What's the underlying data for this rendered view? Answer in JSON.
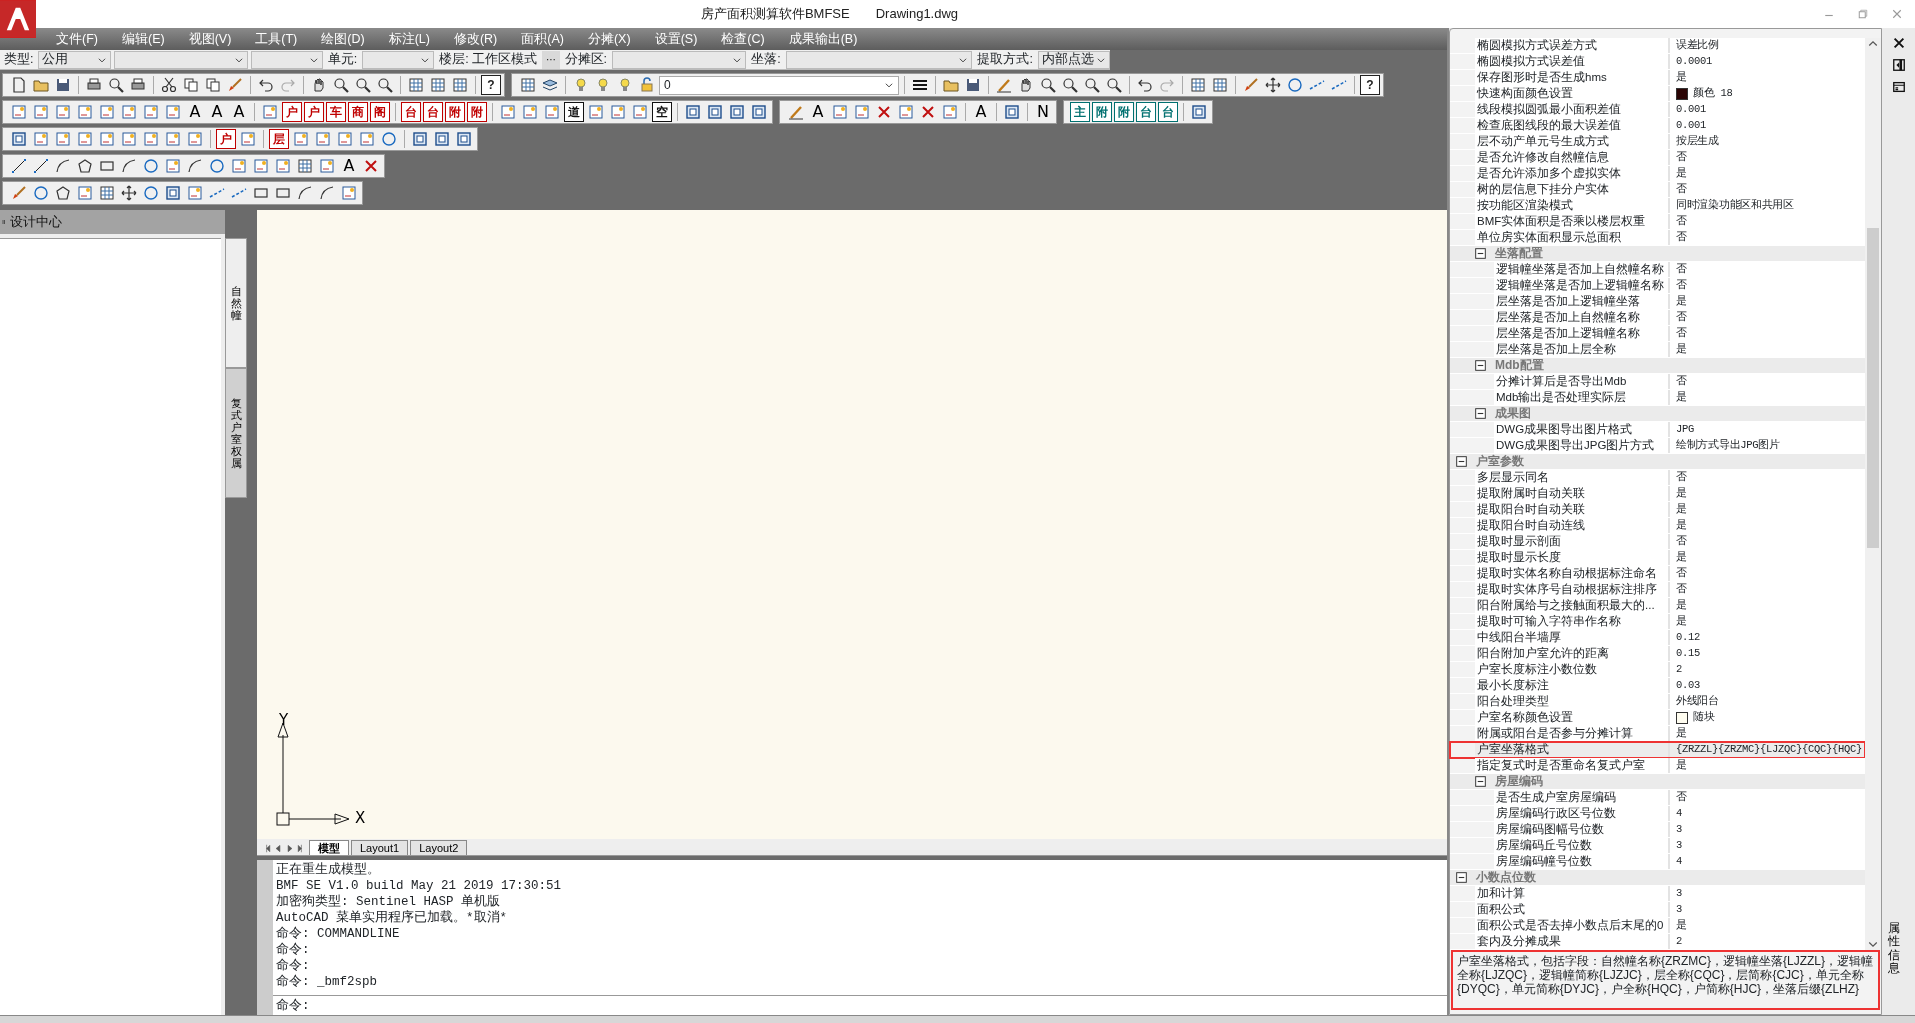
{
  "window": {
    "title": "房产面积测算软件BMFSE",
    "document": "Drawing1.dwg"
  },
  "menu": [
    "文件(F)",
    "编辑(E)",
    "视图(V)",
    "工具(T)",
    "绘图(D)",
    "标注(L)",
    "修改(R)",
    "面积(A)",
    "分摊(X)",
    "设置(S)",
    "检查(C)",
    "成果输出(B)"
  ],
  "filter_bar": [
    {
      "kind": "label",
      "text": "类型:"
    },
    {
      "kind": "combo",
      "value": "公用"
    },
    {
      "kind": "combo"
    },
    {
      "kind": "combo"
    },
    {
      "kind": "label",
      "text": "单元:"
    },
    {
      "kind": "combo"
    },
    {
      "kind": "label",
      "text": "楼层: 工作区模式"
    },
    {
      "kind": "more",
      "text": "···"
    },
    {
      "kind": "label",
      "text": "分摊区:"
    },
    {
      "kind": "combo"
    },
    {
      "kind": "label",
      "text": "坐落:"
    },
    {
      "kind": "combo"
    },
    {
      "kind": "label",
      "text": "提取方式:"
    },
    {
      "kind": "combo",
      "value": "内部点选"
    }
  ],
  "toolbar_rows": [
    {
      "toolbars": [
        {
          "items": [
            {
              "kind": "page"
            },
            {
              "kind": "folder"
            },
            {
              "kind": "disk"
            },
            {
              "kind": "sep"
            },
            {
              "kind": "printer"
            },
            {
              "kind": "zoom"
            },
            {
              "kind": "printer"
            },
            {
              "kind": "sep"
            },
            {
              "kind": "scissors"
            },
            {
              "kind": "copy"
            },
            {
              "kind": "copy"
            },
            {
              "kind": "brush"
            },
            {
              "kind": "sep"
            },
            {
              "kind": "undo"
            },
            {
              "kind": "redo"
            },
            {
              "kind": "sep"
            },
            {
              "kind": "hand"
            },
            {
              "kind": "zoom"
            },
            {
              "kind": "zoom"
            },
            {
              "kind": "zoom"
            },
            {
              "kind": "sep"
            },
            {
              "kind": "grid"
            },
            {
              "kind": "grid"
            },
            {
              "kind": "grid"
            },
            {
              "kind": "sep"
            },
            {
              "kind": "glyph",
              "text": "?",
              "color": "#222222"
            }
          ]
        },
        {
          "items": [
            {
              "kind": "grid"
            },
            {
              "kind": "layers"
            },
            {
              "kind": "sep"
            },
            {
              "kind": "bulb"
            },
            {
              "kind": "bulb"
            },
            {
              "kind": "bulb"
            },
            {
              "kind": "lock"
            },
            {
              "kind": "layer",
              "text": "0"
            },
            {
              "kind": "sep"
            },
            {
              "kind": "lines"
            },
            {
              "kind": "sep"
            },
            {
              "kind": "folder"
            },
            {
              "kind": "disk"
            },
            {
              "kind": "sep"
            },
            {
              "kind": "pencil"
            },
            {
              "kind": "hand"
            },
            {
              "kind": "zoom"
            },
            {
              "kind": "zoom"
            },
            {
              "kind": "zoom"
            },
            {
              "kind": "zoom"
            },
            {
              "kind": "sep"
            },
            {
              "kind": "undo"
            },
            {
              "kind": "redo"
            },
            {
              "kind": "sep"
            },
            {
              "kind": "grid"
            },
            {
              "kind": "grid"
            },
            {
              "kind": "sep"
            },
            {
              "kind": "brush"
            },
            {
              "kind": "move"
            },
            {
              "kind": "circle"
            },
            {
              "kind": "dash"
            },
            {
              "kind": "dash"
            },
            {
              "kind": "sep"
            },
            {
              "kind": "glyph",
              "text": "?",
              "color": "#222222"
            }
          ]
        }
      ]
    },
    {
      "toolbars": [
        {
          "items": [
            {
              "kind": "box"
            },
            {
              "kind": "box"
            },
            {
              "kind": "box"
            },
            {
              "kind": "box"
            },
            {
              "kind": "box"
            },
            {
              "kind": "box"
            },
            {
              "kind": "box"
            },
            {
              "kind": "box"
            },
            {
              "kind": "letter",
              "text": "A"
            },
            {
              "kind": "letter",
              "text": "A"
            },
            {
              "kind": "letter",
              "text": "A"
            },
            {
              "kind": "sep"
            },
            {
              "kind": "box"
            },
            {
              "kind": "glyph",
              "text": "户",
              "color": "#c00000"
            },
            {
              "kind": "glyph",
              "text": "户",
              "color": "#c00000"
            },
            {
              "kind": "glyph",
              "text": "车",
              "color": "#c00000"
            },
            {
              "kind": "glyph",
              "text": "商",
              "color": "#c00000"
            },
            {
              "kind": "glyph",
              "text": "阁",
              "color": "#c00000"
            },
            {
              "kind": "sep"
            },
            {
              "kind": "glyph",
              "text": "台",
              "color": "#c00000"
            },
            {
              "kind": "glyph",
              "text": "台",
              "color": "#c00000"
            },
            {
              "kind": "glyph",
              "text": "附",
              "color": "#c00000"
            },
            {
              "kind": "glyph",
              "text": "附",
              "color": "#c00000"
            },
            {
              "kind": "sep"
            },
            {
              "kind": "box"
            },
            {
              "kind": "box"
            },
            {
              "kind": "box"
            },
            {
              "kind": "glyph",
              "text": "道",
              "color": "#111111"
            },
            {
              "kind": "box"
            },
            {
              "kind": "box"
            },
            {
              "kind": "box"
            },
            {
              "kind": "glyph",
              "text": "空",
              "color": "#111111"
            },
            {
              "kind": "sep"
            },
            {
              "kind": "square"
            },
            {
              "kind": "square"
            },
            {
              "kind": "square"
            },
            {
              "kind": "square"
            }
          ]
        },
        {
          "items": [
            {
              "kind": "pencil"
            },
            {
              "kind": "letter",
              "text": "A"
            },
            {
              "kind": "box"
            },
            {
              "kind": "box"
            },
            {
              "kind": "close"
            },
            {
              "kind": "box"
            },
            {
              "kind": "close"
            },
            {
              "kind": "box"
            },
            {
              "kind": "sep"
            },
            {
              "kind": "letter",
              "text": "A"
            },
            {
              "kind": "sep"
            },
            {
              "kind": "square"
            },
            {
              "kind": "sep"
            },
            {
              "kind": "letter",
              "text": "N"
            }
          ]
        },
        {
          "items": [
            {
              "kind": "glyph",
              "text": "主",
              "color": "#007070"
            },
            {
              "kind": "glyph",
              "text": "附",
              "color": "#007070"
            },
            {
              "kind": "glyph",
              "text": "附",
              "color": "#007070"
            },
            {
              "kind": "glyph",
              "text": "台",
              "color": "#007070"
            },
            {
              "kind": "glyph",
              "text": "台",
              "color": "#007070"
            },
            {
              "kind": "sep"
            },
            {
              "kind": "square"
            }
          ]
        }
      ]
    },
    {
      "toolbars": [
        {
          "items": [
            {
              "kind": "square"
            },
            {
              "kind": "box"
            },
            {
              "kind": "box"
            },
            {
              "kind": "box"
            },
            {
              "kind": "box"
            },
            {
              "kind": "box"
            },
            {
              "kind": "box"
            },
            {
              "kind": "box"
            },
            {
              "kind": "box"
            },
            {
              "kind": "sep"
            },
            {
              "kind": "glyph",
              "text": "户",
              "color": "#c00000"
            },
            {
              "kind": "box"
            },
            {
              "kind": "sep"
            },
            {
              "kind": "glyph",
              "text": "层",
              "color": "#c00000"
            },
            {
              "kind": "box"
            },
            {
              "kind": "box"
            },
            {
              "kind": "box"
            },
            {
              "kind": "box"
            },
            {
              "kind": "circle"
            },
            {
              "kind": "sep"
            },
            {
              "kind": "square"
            },
            {
              "kind": "square"
            },
            {
              "kind": "square"
            }
          ]
        }
      ]
    },
    {
      "toolbars": [
        {
          "items": [
            {
              "kind": "line"
            },
            {
              "kind": "line"
            },
            {
              "kind": "arc"
            },
            {
              "kind": "poly"
            },
            {
              "kind": "rect"
            },
            {
              "kind": "arc"
            },
            {
              "kind": "circle"
            },
            {
              "kind": "box"
            },
            {
              "kind": "arc"
            },
            {
              "kind": "circle"
            },
            {
              "kind": "box"
            },
            {
              "kind": "box"
            },
            {
              "kind": "box"
            },
            {
              "kind": "grid"
            },
            {
              "kind": "box"
            },
            {
              "kind": "letter",
              "text": "A"
            },
            {
              "kind": "close"
            }
          ]
        }
      ]
    },
    {
      "toolbars": [
        {
          "items": [
            {
              "kind": "brush"
            },
            {
              "kind": "circle"
            },
            {
              "kind": "poly"
            },
            {
              "kind": "box"
            },
            {
              "kind": "grid"
            },
            {
              "kind": "move"
            },
            {
              "kind": "circle"
            },
            {
              "kind": "square"
            },
            {
              "kind": "box"
            },
            {
              "kind": "dash"
            },
            {
              "kind": "dash"
            },
            {
              "kind": "rect"
            },
            {
              "kind": "rect"
            },
            {
              "kind": "arc"
            },
            {
              "kind": "arc"
            },
            {
              "kind": "box"
            }
          ]
        }
      ]
    }
  ],
  "design_center": {
    "title": "设计中心",
    "tabs": [
      {
        "label": "自然幢",
        "selected": true
      },
      {
        "label": "复式户室权属",
        "selected": false
      }
    ]
  },
  "canvas": {
    "ucs": {
      "x_label": "X",
      "y_label": "Y"
    },
    "layout_tabs": [
      {
        "label": "模型",
        "selected": true
      },
      {
        "label": "Layout1",
        "selected": false
      },
      {
        "label": "Layout2",
        "selected": false
      }
    ]
  },
  "command_history": [
    "正在重生成模型。",
    "BMF SE V1.0 build May 21 2019 17:30:51",
    "加密狗类型: Sentinel HASP 单机版",
    "AutoCAD 菜单实用程序已加载。*取消*",
    "命令: COMMANDLINE",
    "命令:",
    "命令:",
    "命令: _bmf2spb"
  ],
  "command_prompt": "命令:",
  "property_grid": {
    "items": [
      {
        "kind": "continued",
        "children": [
          {
            "kind": "row",
            "name": "椭圆模拟方式误差方式",
            "value": "误差比例",
            "selected": false,
            "outlined": false
          },
          {
            "kind": "row",
            "name": "椭圆模拟方式误差值",
            "value": "0.0001",
            "selected": false,
            "outlined": false
          },
          {
            "kind": "row",
            "name": "保存图形时是否生成hms",
            "value": "是",
            "selected": false,
            "outlined": false
          },
          {
            "kind": "row",
            "name": "快速构面颜色设置",
            "value": "颜色 18",
            "color": "#2a0404",
            "selected": false,
            "outlined": false
          },
          {
            "kind": "row",
            "name": "线段模拟圆弧最小面积差值",
            "value": "0.001",
            "selected": false,
            "outlined": false
          },
          {
            "kind": "row",
            "name": "检查底图线段的最大误差值",
            "value": "0.001",
            "selected": false,
            "outlined": false
          },
          {
            "kind": "row",
            "name": "层不动产单元号生成方式",
            "value": "按层生成",
            "selected": false,
            "outlined": false
          },
          {
            "kind": "row",
            "name": "是否允许修改自然幢信息",
            "value": "否",
            "selected": false,
            "outlined": false
          },
          {
            "kind": "row",
            "name": "是否允许添加多个虚拟实体",
            "value": "是",
            "selected": false,
            "outlined": false
          },
          {
            "kind": "row",
            "name": "树的层信息下挂分户实体",
            "value": "否",
            "selected": false,
            "outlined": false
          },
          {
            "kind": "row",
            "name": "按功能区渲染模式",
            "value": "同时渲染功能区和共用区",
            "selected": false,
            "outlined": false
          },
          {
            "kind": "row",
            "name": "BMF实体面积是否乘以楼层权重",
            "value": "否",
            "selected": false,
            "outlined": false
          },
          {
            "kind": "row",
            "name": "单位房实体面积显示总面积",
            "value": "否",
            "selected": false,
            "outlined": false
          },
          {
            "kind": "group",
            "name": "坐落配置",
            "expanded": true,
            "children": [
              {
                "kind": "row",
                "name": "逻辑幢坐落是否加上自然幢名称",
                "value": "否",
                "selected": false,
                "outlined": false
              },
              {
                "kind": "row",
                "name": "逻辑幢坐落是否加上逻辑幢名称",
                "value": "否",
                "selected": false,
                "outlined": false
              },
              {
                "kind": "row",
                "name": "层坐落是否加上逻辑幢坐落",
                "value": "是",
                "selected": false,
                "outlined": false
              },
              {
                "kind": "row",
                "name": "层坐落是否加上自然幢名称",
                "value": "否",
                "selected": false,
                "outlined": false
              },
              {
                "kind": "row",
                "name": "层坐落是否加上逻辑幢名称",
                "value": "否",
                "selected": false,
                "outlined": false
              },
              {
                "kind": "row",
                "name": "层坐落是否加上层全称",
                "value": "是",
                "selected": false,
                "outlined": false
              }
            ]
          },
          {
            "kind": "group",
            "name": "Mdb配置",
            "expanded": true,
            "children": [
              {
                "kind": "row",
                "name": "分摊计算后是否导出Mdb",
                "value": "否",
                "selected": false,
                "outlined": false
              },
              {
                "kind": "row",
                "name": "Mdb输出是否处理实际层",
                "value": "是",
                "selected": false,
                "outlined": false
              }
            ]
          },
          {
            "kind": "group",
            "name": "成果图",
            "expanded": true,
            "children": [
              {
                "kind": "row",
                "name": "DWG成果图导出图片格式",
                "value": "JPG",
                "selected": false,
                "outlined": false
              },
              {
                "kind": "row",
                "name": "DWG成果图导出JPG图片方式",
                "value": "绘制方式导出JPG图片",
                "selected": false,
                "outlined": false
              }
            ]
          }
        ]
      },
      {
        "kind": "group",
        "name": "户室参数",
        "expanded": true,
        "children": [
          {
            "kind": "row",
            "name": "多层显示同名",
            "value": "否",
            "selected": false,
            "outlined": false
          },
          {
            "kind": "row",
            "name": "提取附属时自动关联",
            "value": "是",
            "selected": false,
            "outlined": false
          },
          {
            "kind": "row",
            "name": "提取阳台时自动关联",
            "value": "是",
            "selected": false,
            "outlined": false
          },
          {
            "kind": "row",
            "name": "提取阳台时自动连线",
            "value": "是",
            "selected": false,
            "outlined": false
          },
          {
            "kind": "row",
            "name": "提取时显示剖面",
            "value": "否",
            "selected": false,
            "outlined": false
          },
          {
            "kind": "row",
            "name": "提取时显示长度",
            "value": "是",
            "selected": false,
            "outlined": false
          },
          {
            "kind": "row",
            "name": "提取时实体名称自动根据标注命名",
            "value": "否",
            "selected": false,
            "outlined": false
          },
          {
            "kind": "row",
            "name": "提取时实体序号自动根据标注排序",
            "value": "否",
            "selected": false,
            "outlined": false
          },
          {
            "kind": "row",
            "name": "阳台附属给与之接触面积最大的...",
            "value": "是",
            "selected": false,
            "outlined": false
          },
          {
            "kind": "row",
            "name": "提取时可输入字符串作名称",
            "value": "是",
            "selected": false,
            "outlined": false
          },
          {
            "kind": "row",
            "name": "中线阳台半墙厚",
            "value": "0.12",
            "selected": false,
            "outlined": false
          },
          {
            "kind": "row",
            "name": "阳台附加户室允许的距离",
            "value": "0.15",
            "selected": false,
            "outlined": false
          },
          {
            "kind": "row",
            "name": "户室长度标注小数位数",
            "value": "2",
            "selected": false,
            "outlined": false
          },
          {
            "kind": "row",
            "name": "最小长度标注",
            "value": "0.03",
            "selected": false,
            "outlined": false
          },
          {
            "kind": "row",
            "name": "阳台处理类型",
            "value": "外线阳台",
            "selected": false,
            "outlined": false
          },
          {
            "kind": "row",
            "name": "户室名称颜色设置",
            "value": "随块",
            "color": "#fffdf0",
            "selected": false,
            "outlined": false
          },
          {
            "kind": "row",
            "name": "附属或阳台是否参与分摊计算",
            "value": "是",
            "selected": false,
            "outlined": false
          },
          {
            "kind": "row",
            "name": "户室坐落格式",
            "value": "{ZRZZL}{ZRZMC}{LJZQC}{CQC}{HQC}",
            "selected": true,
            "outlined": true
          },
          {
            "kind": "row",
            "name": "指定复式时是否重命名复式户室",
            "value": "是",
            "selected": false,
            "outlined": false
          },
          {
            "kind": "group",
            "name": "房屋编码",
            "expanded": true,
            "children": [
              {
                "kind": "row",
                "name": "是否生成户室房屋编码",
                "value": "否",
                "selected": false,
                "outlined": false
              },
              {
                "kind": "row",
                "name": "房屋编码行政区号位数",
                "value": "4",
                "selected": false,
                "outlined": false
              },
              {
                "kind": "row",
                "name": "房屋编码图幅号位数",
                "value": "3",
                "selected": false,
                "outlined": false
              },
              {
                "kind": "row",
                "name": "房屋编码丘号位数",
                "value": "3",
                "selected": false,
                "outlined": false
              },
              {
                "kind": "row",
                "name": "房屋编码幢号位数",
                "value": "4",
                "selected": false,
                "outlined": false
              }
            ]
          }
        ]
      },
      {
        "kind": "group",
        "name": "小数点位数",
        "expanded": true,
        "children": [
          {
            "kind": "row",
            "name": "加和计算",
            "value": "3",
            "selected": false,
            "outlined": false
          },
          {
            "kind": "row",
            "name": "面积公式",
            "value": "3",
            "selected": false,
            "outlined": false
          },
          {
            "kind": "row",
            "name": "面积公式是否去掉小数点后末尾的0",
            "value": "是",
            "selected": false,
            "outlined": false
          },
          {
            "kind": "row",
            "name": "套内及分摊成果",
            "value": "2",
            "selected": false,
            "outlined": false
          }
        ]
      }
    ],
    "description": "户室坐落格式，包括字段：自然幢名称{ZRZMC}，逻辑幢坐落{LJZZL}，逻辑幢全称{LJZQC}，逻辑幢简称{LJZJC}，层全称{CQC}，层简称{CJC}，单元全称{DYQC}，单元简称{DYJC}，户全称{HQC}，户简称{HJC}，坐落后缀{ZLHZ}",
    "description_outlined": true
  },
  "side_tab": {
    "label": "属性信息"
  }
}
